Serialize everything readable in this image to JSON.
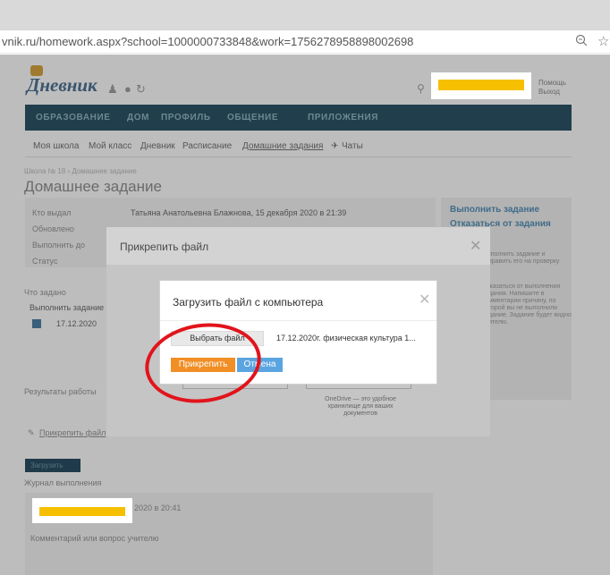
{
  "browser": {
    "url": "vnik.ru/homework.aspx?school=1000000733848&work=1756278958898002698",
    "zoom_icon": "zoom-icon",
    "star_icon": "star-icon"
  },
  "header": {
    "logo": "Дневник",
    "links": [
      "Помощь",
      "Выход"
    ]
  },
  "nav": {
    "items": [
      "ОБРАЗОВАНИЕ",
      "ДОМ",
      "ПРОФИЛЬ",
      "ОБЩЕНИЕ",
      "ПРИЛОЖЕНИЯ"
    ]
  },
  "subnav": {
    "items": [
      "Моя школа",
      "Мой класс",
      "Дневник",
      "Расписание",
      "Домашние задания",
      "Чаты"
    ]
  },
  "page": {
    "breadcrumb": "Школа № 18 › Домашнее задание",
    "title": "Домашнее задание",
    "info": {
      "labels": [
        "Кто выдал",
        "Обновлено",
        "Выполнить до",
        "Статус"
      ],
      "issued_by": "Татьяна Анатольевна Блажнова, 15 декабря 2020 в 21:39"
    },
    "task_label": "Что задано",
    "task_text": "Выполнить задание",
    "file_date": "17.12.2020",
    "results_label": "Результаты работы",
    "attach_link": "Прикрепить файл",
    "execute_button": "Загрузить",
    "journal_label": "Журнал выполнения",
    "journal_time": "2020 в 20:41",
    "comment_label": "Комментарий или вопрос учителю"
  },
  "right_panel": {
    "do_task": "Выполнить задание",
    "refuse_task": "Отказаться от задания",
    "note1": "Выполнить задание и отправить его на проверку",
    "note2": "Отказаться от выполнения задания. Напишите в комментарии причину, по которой вы не выполнили задание. Задание будет видно учителю."
  },
  "dialog_outer": {
    "title": "Прикрепить файл",
    "onedrive_caption": "OneDrive — это удобное хранилище для ваших документов"
  },
  "dialog_inner": {
    "title": "Загрузить файл с компьютера",
    "choose_button": "Выбрать файл",
    "file_name": "17.12.2020г. физическая культура 1...",
    "attach_button": "Прикрепить",
    "cancel_button": "Отмена"
  },
  "colors": {
    "annotation": "#e1141c",
    "attach": "#f18e25",
    "cancel": "#5aa5e0",
    "navbar": "#203e4c",
    "redaction": "#f6bf00"
  }
}
